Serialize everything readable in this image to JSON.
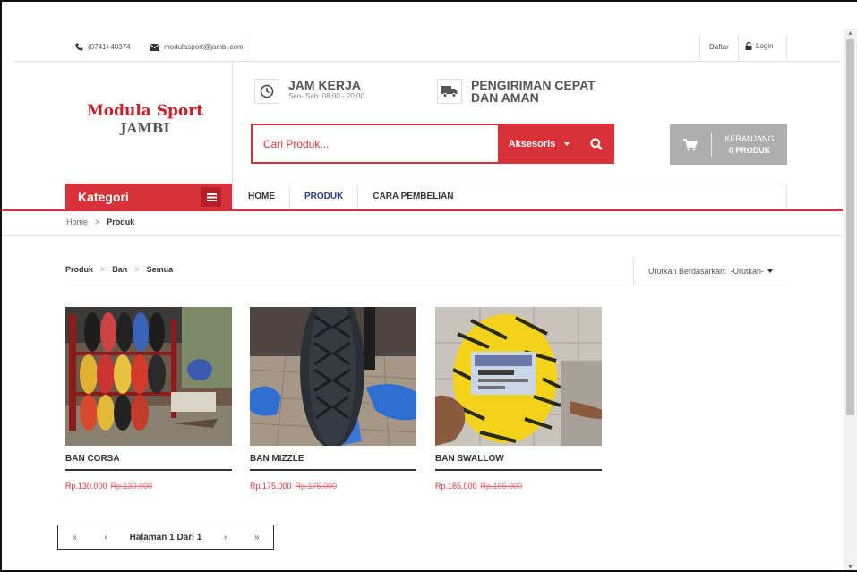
{
  "topbar": {
    "phone": "(0741) 40374",
    "email": "modulasport@jambi.com",
    "register": "Daftar",
    "login": "Login"
  },
  "logo": {
    "line1": "Modula Sport",
    "line2": "JAMBI"
  },
  "info": {
    "hours_title": "JAM KERJA",
    "hours_sub": "Sen- Sab: 08:00 - 20:00",
    "shipping_line1": "PENGIRIMAN CEPAT",
    "shipping_line2": "DAN AMAN"
  },
  "search": {
    "placeholder": "Cari Produk...",
    "category": "Aksesoris"
  },
  "cart": {
    "label": "KERANJANG",
    "count": "0 PRODUK"
  },
  "nav": {
    "kategori": "Kategori",
    "items": [
      {
        "label": "HOME"
      },
      {
        "label": "PRODUK"
      },
      {
        "label": "CARA PEMBELIAN"
      }
    ]
  },
  "breadcrumb": {
    "home": "Home",
    "sep": ">",
    "current": "Produk"
  },
  "filter": {
    "path": [
      "Produk",
      "Ban",
      "Semua"
    ],
    "sep": ">",
    "sort_label": "Urutkan Berdasarkan:",
    "sort_value": "-Urutkan-"
  },
  "products": [
    {
      "name": "BAN CORSA",
      "price": "Rp.130.000",
      "old_price": "Rp.130.000"
    },
    {
      "name": "BAN MIZZLE",
      "price": "Rp.175.000",
      "old_price": "Rp.175.000"
    },
    {
      "name": "BAN SWALLOW",
      "price": "Rp.165.000",
      "old_price": "Rp.165.000"
    }
  ],
  "pager": {
    "first": "«",
    "prev": "‹",
    "label": "Halaman 1 Dari 1",
    "next": "›",
    "last": "»"
  },
  "colors": {
    "accent": "#d9313a",
    "nav_active": "#2b3a8f",
    "cart_bg": "#aeaeae"
  }
}
